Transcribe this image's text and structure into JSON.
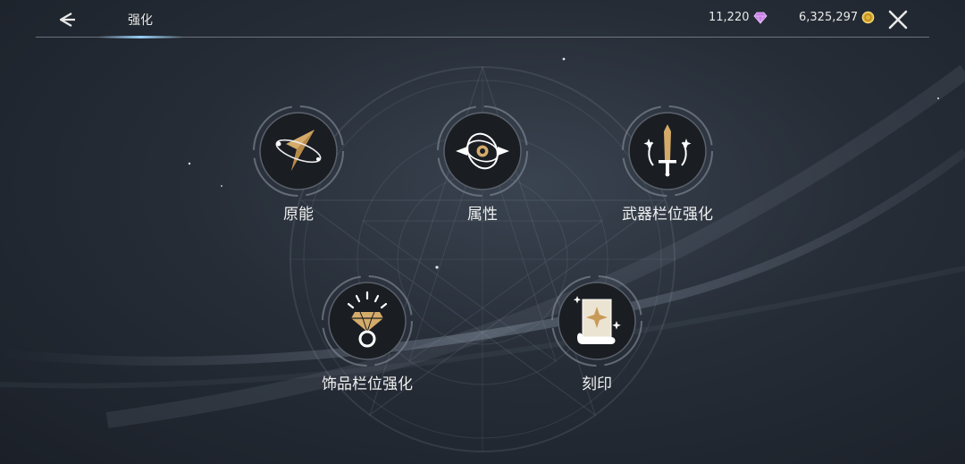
{
  "header": {
    "title": "强化",
    "gem_amount": "11,220",
    "gold_amount": "6,325,297"
  },
  "menu": {
    "items": [
      {
        "label": "原能",
        "icon": "origin-energy-icon"
      },
      {
        "label": "属性",
        "icon": "attribute-orb-icon"
      },
      {
        "label": "武器栏位强化",
        "icon": "sword-icon"
      },
      {
        "label": "饰品栏位强化",
        "icon": "diamond-ring-icon"
      },
      {
        "label": "刻印",
        "icon": "engraving-scroll-icon"
      }
    ]
  },
  "colors": {
    "accent_gold": "#d4ab6a",
    "gem_purple": "#c77ce6",
    "coin_gold": "#e2b33a",
    "header_highlight": "#96cdf5"
  }
}
